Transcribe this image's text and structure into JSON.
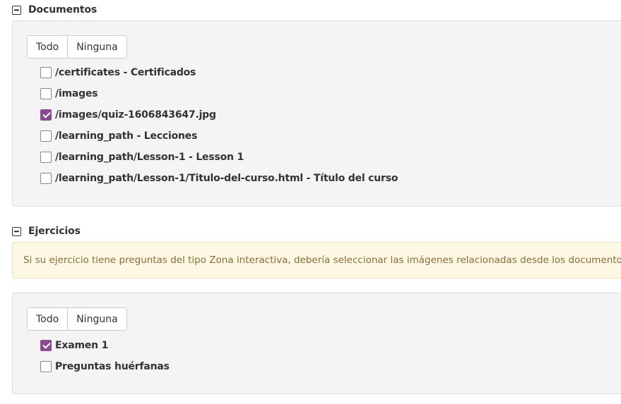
{
  "documents": {
    "title": "Documentos",
    "select_all_label": "Todo",
    "select_none_label": "Ninguna",
    "items": [
      {
        "label": "/certificates - Certificados",
        "checked": false
      },
      {
        "label": "/images",
        "checked": false
      },
      {
        "label": "/images/quiz-1606843647.jpg",
        "checked": true
      },
      {
        "label": "/learning_path - Lecciones",
        "checked": false
      },
      {
        "label": "/learning_path/Lesson-1 - Lesson 1",
        "checked": false
      },
      {
        "label": "/learning_path/Lesson-1/Titulo-del-curso.html - Título del curso",
        "checked": false
      }
    ]
  },
  "exercises": {
    "title": "Ejercicios",
    "notice": "Si su ejercicio tiene preguntas del tipo Zona interactiva, debería seleccionar las imágenes relacionadas desde los documentos.",
    "select_all_label": "Todo",
    "select_none_label": "Ninguna",
    "items": [
      {
        "label": "Examen 1",
        "checked": true
      },
      {
        "label": "Preguntas huérfanas",
        "checked": false
      }
    ]
  },
  "colors": {
    "checkbox_checked": "#8a4a8f",
    "panel_background": "#f4f4f4",
    "notice_background": "#fcf8e3",
    "notice_text": "#8a6d3b"
  }
}
